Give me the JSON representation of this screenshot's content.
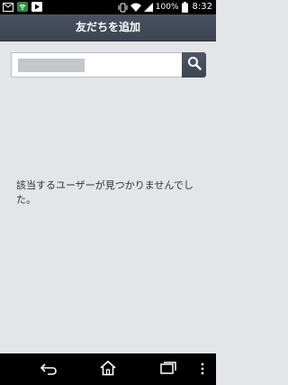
{
  "status_bar": {
    "battery_percent": "100%",
    "clock": "8:32",
    "left_icons": [
      "envelope-icon",
      "wifi-app-icon",
      "play-store-icon"
    ],
    "right_icons": [
      "vibrate-icon",
      "wifi-signal-icon",
      "cell-signal-icon",
      "battery-icon"
    ]
  },
  "header": {
    "title": "友だちを追加"
  },
  "search": {
    "button_icon": "search-icon"
  },
  "results": {
    "empty_message": "該当するユーザーが見つかりませんでした。"
  },
  "nav_bar": {
    "buttons": [
      "back-icon",
      "home-icon",
      "recent-apps-icon",
      "menu-icon"
    ]
  },
  "colors": {
    "background": "#e4e5e9",
    "header": "#454c5b",
    "search_button": "#454c5b"
  }
}
